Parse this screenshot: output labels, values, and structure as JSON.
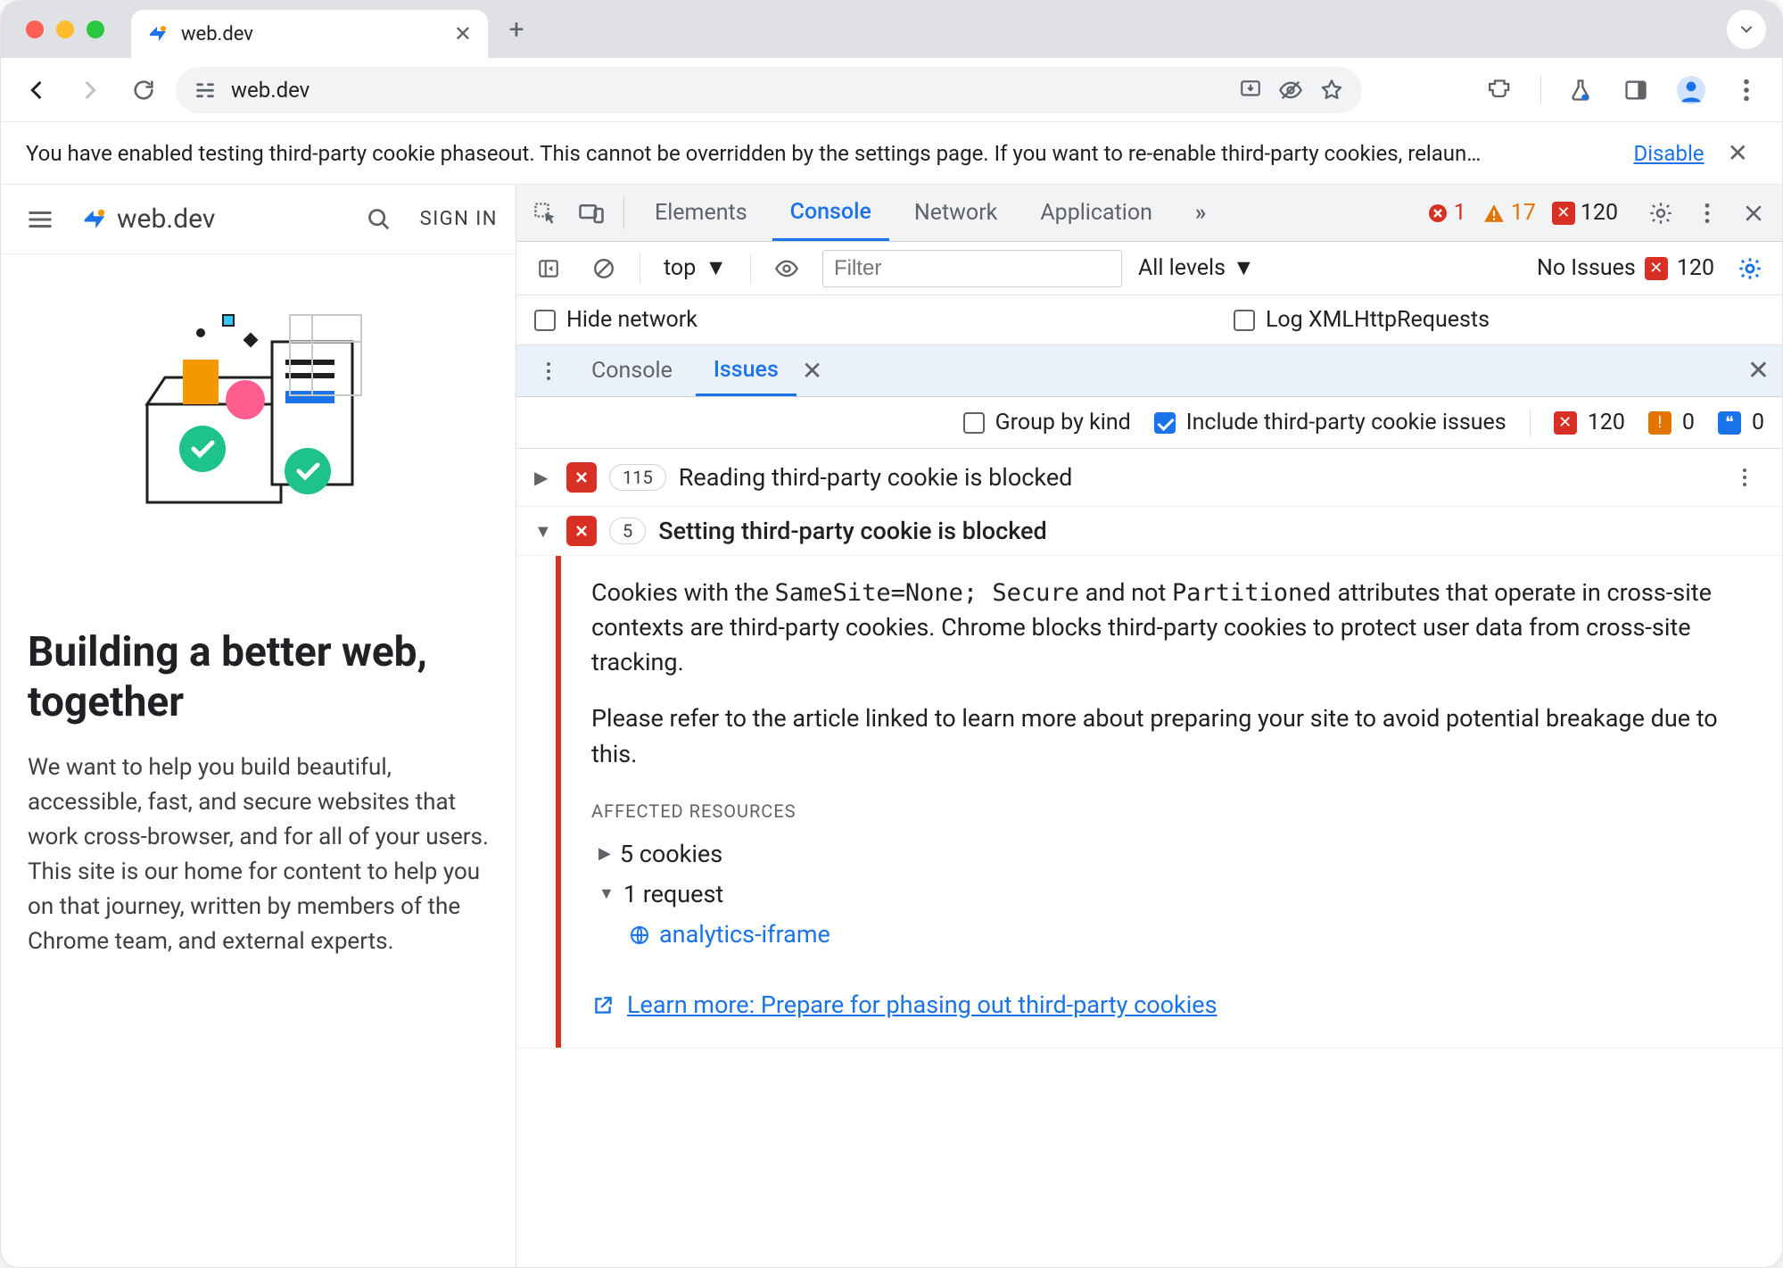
{
  "browser": {
    "tab_title": "web.dev",
    "url": "web.dev",
    "new_tab_plus": "+",
    "chevron": "⌄"
  },
  "infobar": {
    "text": "You have enabled testing third-party cookie phaseout. This cannot be overridden by the settings page. If you want to re-enable third-party cookies, relaun…",
    "link": "Disable"
  },
  "page": {
    "brand": "web.dev",
    "signin": "SIGN IN",
    "headline": "Building a better web, together",
    "subcopy": "We want to help you build beautiful, accessible, fast, and secure websites that work cross-browser, and for all of your users. This site is our home for content to help you on that journey, written by members of the Chrome team, and external experts."
  },
  "devtools": {
    "tabs": {
      "elements": "Elements",
      "console": "Console",
      "network": "Network",
      "application": "Application",
      "more": "»"
    },
    "counters": {
      "errors": "1",
      "warnings": "17",
      "issues": "120"
    },
    "console_bar": {
      "context": "top",
      "filter_placeholder": "Filter",
      "levels": "All levels",
      "no_issues": "No Issues",
      "no_issues_count": "120"
    },
    "checks": {
      "hide_network": "Hide network",
      "log_xhr": "Log XMLHttpRequests"
    },
    "drawer_tabs": {
      "console": "Console",
      "issues": "Issues"
    },
    "issues_filter": {
      "group_by_kind": "Group by kind",
      "include_tpc": "Include third-party cookie issues",
      "red_count": "120",
      "orange_count": "0",
      "blue_count": "0"
    },
    "issues": [
      {
        "count": "115",
        "title": "Reading third-party cookie is blocked",
        "expanded": false
      },
      {
        "count": "5",
        "title": "Setting third-party cookie is blocked",
        "expanded": true
      }
    ],
    "issue_detail": {
      "p1_a": "Cookies with the ",
      "code1": "SameSite=None; Secure",
      "p1_b": " and not ",
      "code2": "Partitioned",
      "p1_c": " attributes that operate in cross-site contexts are third-party cookies. Chrome blocks third-party cookies to protect user data from cross-site tracking.",
      "p2": "Please refer to the article linked to learn more about preparing your site to avoid potential breakage due to this.",
      "affected_head": "AFFECTED RESOURCES",
      "aff_cookies": "5 cookies",
      "aff_requests": "1 request",
      "request_name": "analytics-iframe",
      "learn_more": "Learn more: Prepare for phasing out third-party cookies"
    }
  }
}
